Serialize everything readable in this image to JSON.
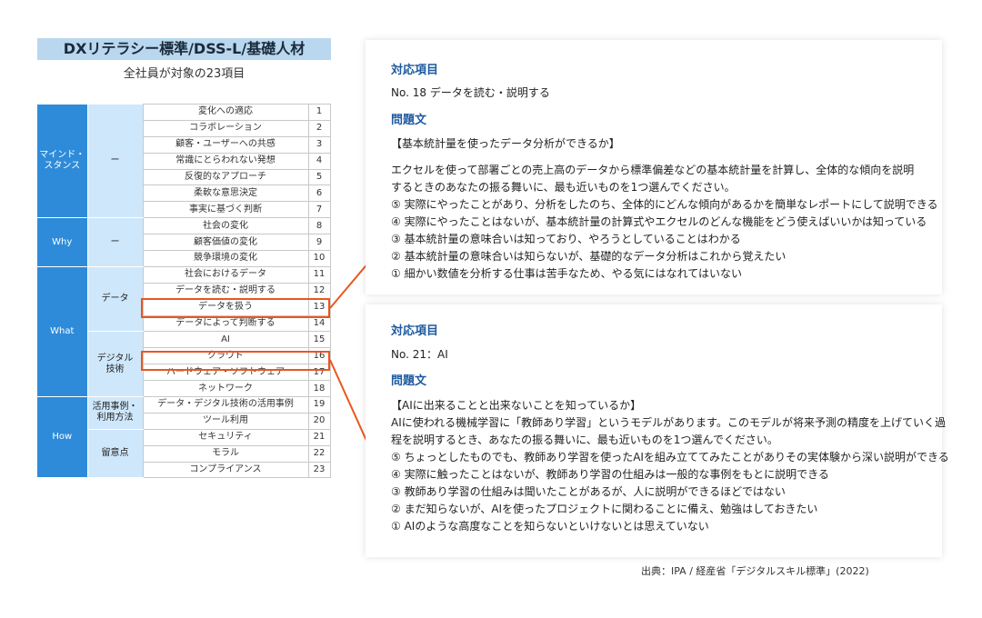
{
  "title": "DXリテラシー標準/DSS-L/基礎人材",
  "subtitle": "全社員が対象の23項目",
  "categories": {
    "mind": "マインド・\nスタンス",
    "why": "Why",
    "what": "What",
    "how": "How"
  },
  "subcategories": {
    "mind_dash": "ー",
    "why_dash": "ー",
    "data": "データ",
    "digital": "デジタル\n技術",
    "cases": "活用事例・\n利用方法",
    "notes": "留意点"
  },
  "items": [
    {
      "label": "変化への適応",
      "num": "1"
    },
    {
      "label": "コラボレーション",
      "num": "2"
    },
    {
      "label": "顧客・ユーザーへの共感",
      "num": "3"
    },
    {
      "label": "常識にとらわれない発想",
      "num": "4"
    },
    {
      "label": "反復的なアプローチ",
      "num": "5"
    },
    {
      "label": "柔軟な意思決定",
      "num": "6"
    },
    {
      "label": "事実に基づく判断",
      "num": "7"
    },
    {
      "label": "社会の変化",
      "num": "8"
    },
    {
      "label": "顧客価値の変化",
      "num": "9"
    },
    {
      "label": "競争環境の変化",
      "num": "10"
    },
    {
      "label": "社会におけるデータ",
      "num": "11"
    },
    {
      "label": "データを読む・説明する",
      "num": "12"
    },
    {
      "label": "データを扱う",
      "num": "13"
    },
    {
      "label": "データによって判断する",
      "num": "14"
    },
    {
      "label": "AI",
      "num": "15"
    },
    {
      "label": "クラウド",
      "num": "16"
    },
    {
      "label": "ハードウェア・ソフトウェア",
      "num": "17"
    },
    {
      "label": "ネットワーク",
      "num": "18"
    },
    {
      "label": "データ・デジタル技術の活用事例",
      "num": "19"
    },
    {
      "label": "ツール利用",
      "num": "20"
    },
    {
      "label": "セキュリティ",
      "num": "21"
    },
    {
      "label": "モラル",
      "num": "22"
    },
    {
      "label": "コンプライアンス",
      "num": "23"
    }
  ],
  "card1": {
    "item_label": "対応項目",
    "item_value": "No. 18 データを読む・説明する",
    "question_label": "問題文",
    "heading": "【基本統計量を使ったデータ分析ができるか】",
    "body_line1": "エクセルを使って部署ごとの売上高のデータから標準偏差などの基本統計量を計算し、全体的な傾向を説明",
    "body_line2": "するときのあなたの振る舞いに、最も近いものを1つ選んでください。",
    "options": [
      "⑤ 実際にやったことがあり、分析をしたのち、全体的にどんな傾向があるかを簡単なレポートにして説明できる",
      "④ 実際にやったことはないが、基本統計量の計算式やエクセルのどんな機能をどう使えばいいかは知っている",
      "③ 基本統計量の意味合いは知っており、やろうとしていることはわかる",
      "② 基本統計量の意味合いは知らないが、基礎的なデータ分析はこれから覚えたい",
      "① 細かい数値を分析する仕事は苦手なため、やる気にはなれてはいない"
    ]
  },
  "card2": {
    "item_label": "対応項目",
    "item_value": "No. 21：AI",
    "question_label": "問題文",
    "heading": "【AIに出来ることと出来ないことを知っているか】",
    "body_line1": "AIに使われる機械学習に「教師あり学習」というモデルがあります。このモデルが将来予測の精度を上げていく過",
    "body_line2": "程を説明するとき、あなたの振る舞いに、最も近いものを1つ選んでください。",
    "options": [
      "⑤ ちょっとしたものでも、教師あり学習を使ったAIを組み立ててみたことがありその実体験から深い説明ができる",
      "④ 実際に触ったことはないが、教師あり学習の仕組みは一般的な事例をもとに説明できる",
      "③ 教師あり学習の仕組みは聞いたことがあるが、人に説明ができるほどではない",
      "② まだ知らないが、AIを使ったプロジェクトに関わることに備え、勉強はしておきたい",
      "① AIのような高度なことを知らないといけないとは思えていない"
    ]
  },
  "source": "出典：IPA / 経産省「デジタルスキル標準」(2022)",
  "colors": {
    "category_bg": "#2e8bd9",
    "subcategory_bg": "#cfe7fb",
    "title_bg": "#b9d7ee",
    "highlight": "#e8571e",
    "label_text": "#1e5aa0"
  }
}
